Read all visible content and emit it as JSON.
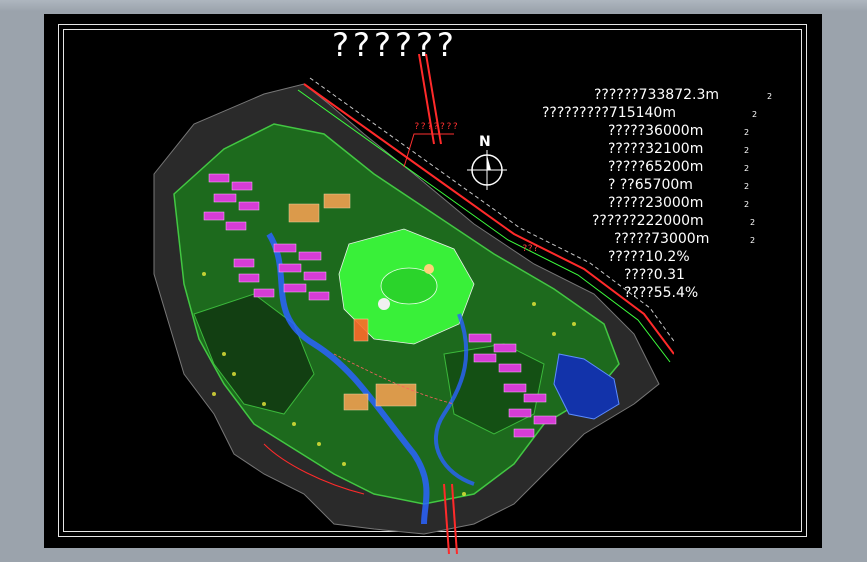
{
  "window": {
    "background": "#9ba3ac",
    "canvas_color": "#000000"
  },
  "drawing": {
    "title": "??????",
    "north_label": "N",
    "callout_label": "???????",
    "road_callout_label": "???",
    "stats": [
      {
        "text": "??????733872.3m",
        "sup": "2"
      },
      {
        "text": "?????????715140m",
        "sup": "2"
      },
      {
        "text": "?????36000m",
        "sup": "2"
      },
      {
        "text": "?????32100m",
        "sup": "2"
      },
      {
        "text": "?????65200m",
        "sup": "2"
      },
      {
        "text": "?      ??65700m",
        "sup": "2"
      },
      {
        "text": "?????23000m",
        "sup": "2"
      },
      {
        "text": "??????222000m",
        "sup": "2"
      },
      {
        "text": "?????73000m",
        "sup": "2"
      },
      {
        "text": "?????10.2%",
        "sup": ""
      },
      {
        "text": "????0.31",
        "sup": ""
      },
      {
        "text": "????55.4%",
        "sup": ""
      }
    ],
    "colors": {
      "frame": "#e6e6e6",
      "text": "#ffffff",
      "road": "#ff2a2a",
      "vegetation": "#22c522",
      "green_core": "#3dff3d",
      "residential": "#d63cd6",
      "water": "#2a63ff",
      "built": "#f0a050",
      "contour": "#7a7a7a"
    }
  }
}
